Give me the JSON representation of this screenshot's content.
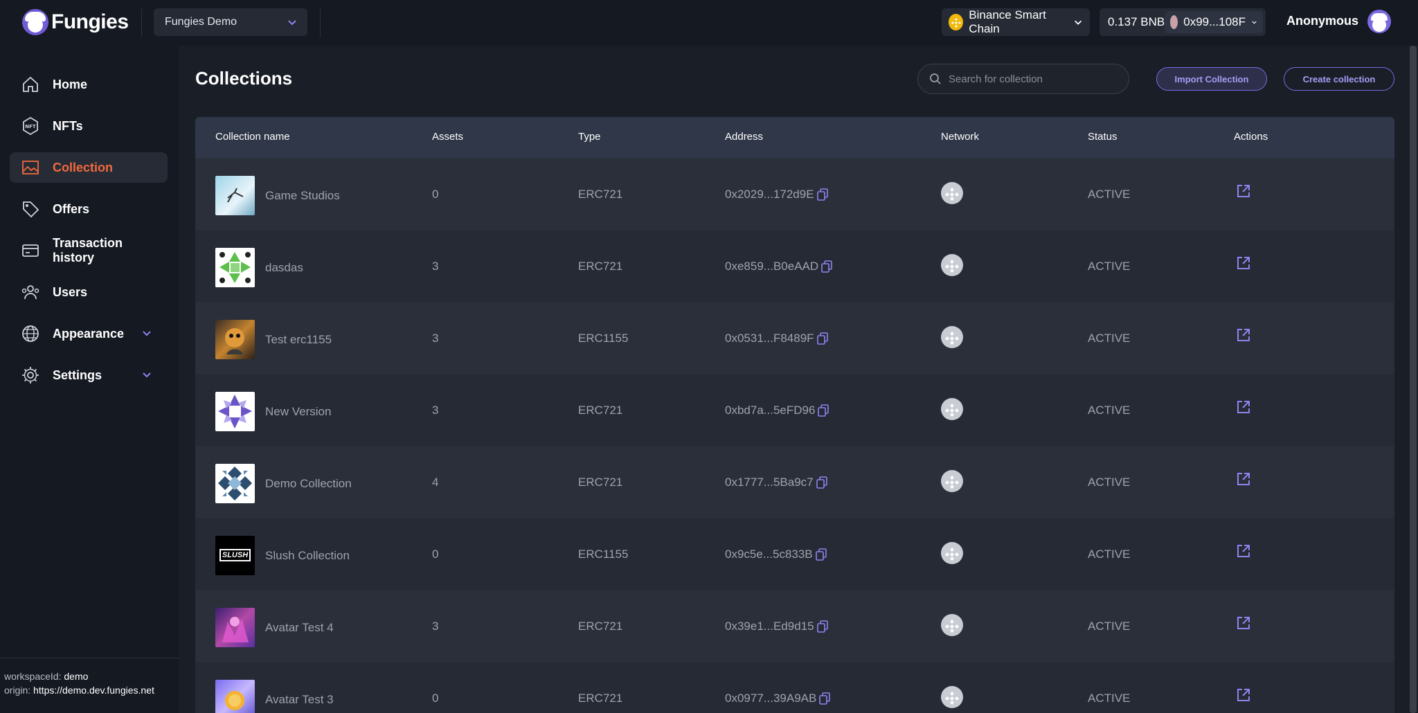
{
  "app": {
    "name": "Fungies"
  },
  "topbar": {
    "workspace": "Fungies Demo",
    "chain": "Binance Smart Chain",
    "balance": "0.137 BNB",
    "wallet": "0x99...108F",
    "user": "Anonymous"
  },
  "colors": {
    "accent": "#7b6ae0",
    "active_nav": "#f26a3d",
    "bnb": "#f0b90b"
  },
  "sidebar": {
    "items": [
      {
        "label": "Home",
        "icon": "home-icon"
      },
      {
        "label": "NFTs",
        "icon": "nft-icon"
      },
      {
        "label": "Collection",
        "icon": "collection-icon",
        "active": true
      },
      {
        "label": "Offers",
        "icon": "tag-icon"
      },
      {
        "label": "Transaction history",
        "icon": "receipt-icon"
      },
      {
        "label": "Users",
        "icon": "users-icon"
      },
      {
        "label": "Appearance",
        "icon": "globe-icon",
        "expandable": true
      },
      {
        "label": "Settings",
        "icon": "gear-icon",
        "expandable": true
      }
    ],
    "footer": {
      "workspace_label": "workspaceId:",
      "workspace_value": "demo",
      "origin_label": "origin:",
      "origin_value": "https://demo.dev.fungies.net"
    }
  },
  "main": {
    "title": "Collections",
    "search_placeholder": "Search for collection",
    "import_label": "Import Collection",
    "create_label": "Create collection",
    "columns": [
      "Collection name",
      "Assets",
      "Type",
      "Address",
      "Network",
      "Status",
      "Actions"
    ],
    "rows": [
      {
        "name": "Game Studios",
        "assets": "0",
        "type": "ERC721",
        "address": "0x2029...172d9E",
        "status": "ACTIVE"
      },
      {
        "name": "dasdas",
        "assets": "3",
        "type": "ERC721",
        "address": "0xe859...B0eAAD",
        "status": "ACTIVE"
      },
      {
        "name": "Test erc1155",
        "assets": "3",
        "type": "ERC1155",
        "address": "0x0531...F8489F",
        "status": "ACTIVE"
      },
      {
        "name": "New Version",
        "assets": "3",
        "type": "ERC721",
        "address": "0xbd7a...5eFD96",
        "status": "ACTIVE"
      },
      {
        "name": "Demo Collection",
        "assets": "4",
        "type": "ERC721",
        "address": "0x1777...5Ba9c7",
        "status": "ACTIVE"
      },
      {
        "name": "Slush Collection",
        "assets": "0",
        "type": "ERC1155",
        "address": "0x9c5e...5c833B",
        "status": "ACTIVE"
      },
      {
        "name": "Avatar Test 4",
        "assets": "3",
        "type": "ERC721",
        "address": "0x39e1...Ed9d15",
        "status": "ACTIVE"
      },
      {
        "name": "Avatar Test 3",
        "assets": "0",
        "type": "ERC721",
        "address": "0x0977...39A9AB",
        "status": "ACTIVE"
      }
    ],
    "thumb_texts": {
      "slush": "SLUSH"
    }
  }
}
